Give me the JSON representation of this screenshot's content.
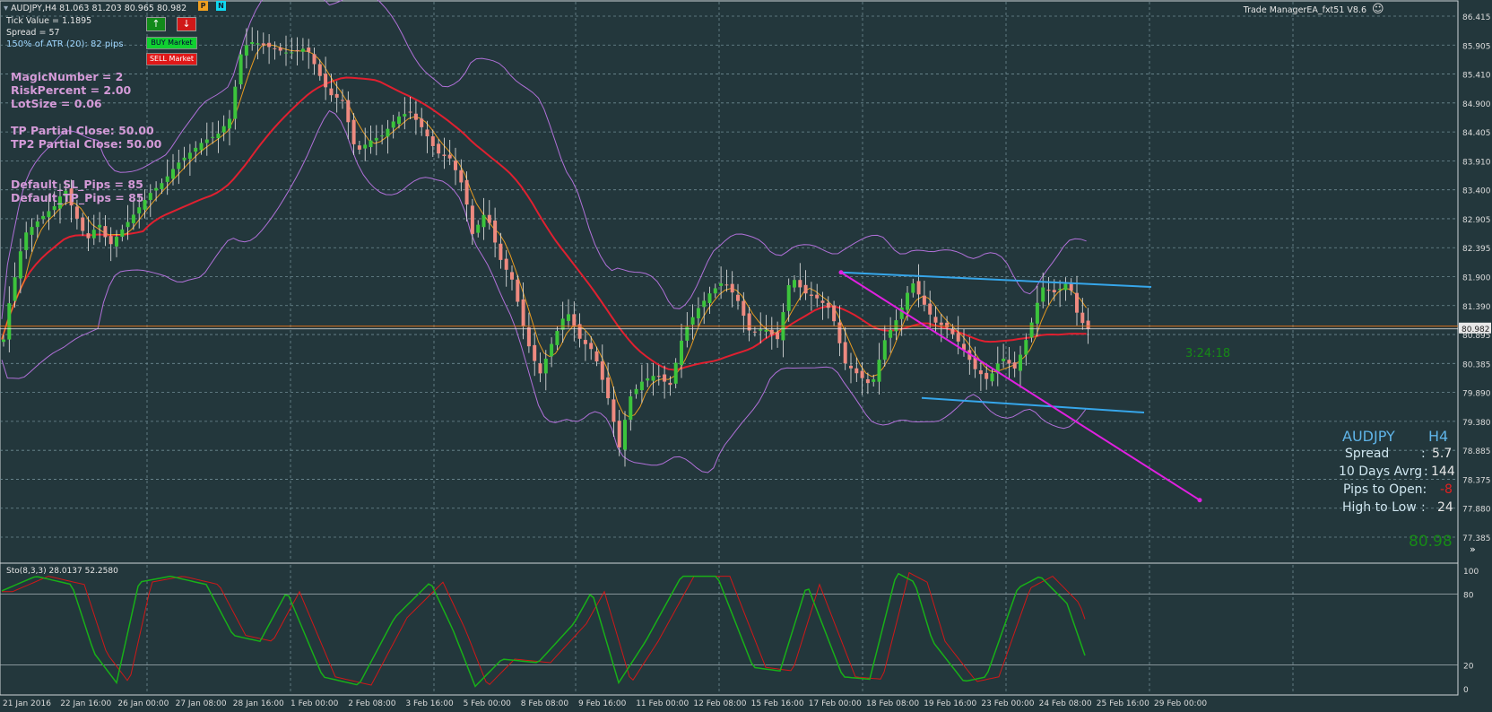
{
  "header": {
    "symbol_line": "AUDJPY,H4  81.063 81.203 80.965 80.982",
    "tick_value": "Tick Value = 1.1895",
    "spread": "Spread = 57",
    "atr": "150% of ATR (20): 82 pips",
    "ea_name": "Trade ManagerEA_fxt51 V8.6"
  },
  "buttons": {
    "up_arrow": "↑",
    "down_arrow": "↓",
    "p_label": "P",
    "n_label": "N",
    "buy": "BUY Market",
    "sell": "SELL Market"
  },
  "params": {
    "magic": "MagicNumber = 2",
    "risk": "RiskPercent = 2.00",
    "lot": "LotSize = 0.06",
    "tp1": "TP Partial Close: 50.00",
    "tp2": "TP2 Partial Close: 50.00",
    "sl": "Default_SL_Pips = 85",
    "tp": "Default_TP_Pips = 85"
  },
  "info_panel": {
    "symbol": "AUDJPY",
    "timeframe": "H4",
    "spread_label": "Spread",
    "spread_value": "5.7",
    "avg_label": "10 Days Avrg",
    "avg_value": "144",
    "pips_open_label": "Pips to Open:",
    "pips_open_value": "-8",
    "hl_label": "High to Low",
    "hl_value": "24",
    "price": "80.98",
    "countdown": "3:24:18"
  },
  "current_price_label": "80.982",
  "price_axis": [
    "86.415",
    "85.905",
    "85.410",
    "84.900",
    "84.405",
    "83.910",
    "83.400",
    "82.905",
    "82.395",
    "81.900",
    "81.390",
    "80.895",
    "80.385",
    "79.890",
    "79.380",
    "78.885",
    "78.375",
    "77.880",
    "77.385"
  ],
  "time_axis": [
    "21 Jan 2016",
    "22 Jan 16:00",
    "26 Jan 00:00",
    "27 Jan 08:00",
    "28 Jan 16:00",
    "1 Feb 00:00",
    "2 Feb 08:00",
    "3 Feb 16:00",
    "5 Feb 00:00",
    "8 Feb 08:00",
    "9 Feb 16:00",
    "11 Feb 00:00",
    "12 Feb 08:00",
    "15 Feb 16:00",
    "17 Feb 00:00",
    "18 Feb 08:00",
    "19 Feb 16:00",
    "23 Feb 00:00",
    "24 Feb 08:00",
    "25 Feb 16:00",
    "29 Feb 00:00"
  ],
  "stoch": {
    "label": "Sto(8,3,3) 28.0137 52.2580",
    "levels": [
      "100",
      "80",
      "20",
      "0"
    ]
  },
  "colors": {
    "background": "#23373c",
    "bull": "#3cc43c",
    "bear": "#ee8a80",
    "ma_red": "#e02030",
    "ma_blue": "#4a7ee8",
    "ma_orange": "#e79a20",
    "bands": "#b070d8",
    "trend_magenta": "#e020e0",
    "channel_blue": "#36a6ea",
    "stoch_main": "#18b018",
    "stoch_signal": "#d01818"
  },
  "chart_data": {
    "type": "candlestick",
    "symbol": "AUDJPY",
    "timeframe": "H4",
    "last": {
      "open": 81.063,
      "high": 81.203,
      "low": 80.965,
      "close": 80.982
    },
    "ylim": [
      77.385,
      86.415
    ],
    "anchors": [
      [
        0,
        80.6
      ],
      [
        8,
        81.4
      ],
      [
        25,
        82.6
      ],
      [
        45,
        82.9
      ],
      [
        60,
        83.1
      ],
      [
        70,
        83.4
      ],
      [
        80,
        83.0
      ],
      [
        95,
        82.5
      ],
      [
        108,
        82.8
      ],
      [
        120,
        82.4
      ],
      [
        135,
        82.7
      ],
      [
        150,
        83.0
      ],
      [
        165,
        83.3
      ],
      [
        180,
        83.5
      ],
      [
        195,
        83.8
      ],
      [
        210,
        84.0
      ],
      [
        225,
        84.2
      ],
      [
        240,
        84.3
      ],
      [
        255,
        84.6
      ],
      [
        262,
        85.3
      ],
      [
        268,
        85.8
      ],
      [
        280,
        85.9
      ],
      [
        300,
        85.8
      ],
      [
        320,
        85.7
      ],
      [
        340,
        85.8
      ],
      [
        352,
        85.4
      ],
      [
        365,
        85.0
      ],
      [
        380,
        84.9
      ],
      [
        395,
        84.0
      ],
      [
        410,
        84.2
      ],
      [
        425,
        84.3
      ],
      [
        440,
        84.6
      ],
      [
        455,
        84.7
      ],
      [
        470,
        84.4
      ],
      [
        485,
        84.0
      ],
      [
        500,
        83.9
      ],
      [
        515,
        83.4
      ],
      [
        525,
        82.6
      ],
      [
        540,
        83.0
      ],
      [
        555,
        82.2
      ],
      [
        570,
        81.8
      ],
      [
        585,
        80.8
      ],
      [
        600,
        80.2
      ],
      [
        615,
        80.8
      ],
      [
        630,
        81.3
      ],
      [
        645,
        80.8
      ],
      [
        660,
        80.6
      ],
      [
        670,
        80.1
      ],
      [
        680,
        79.6
      ],
      [
        688,
        78.9
      ],
      [
        700,
        79.8
      ],
      [
        715,
        80.1
      ],
      [
        730,
        80.2
      ],
      [
        745,
        80.0
      ],
      [
        760,
        80.9
      ],
      [
        775,
        81.3
      ],
      [
        790,
        81.6
      ],
      [
        805,
        81.8
      ],
      [
        820,
        81.5
      ],
      [
        835,
        80.9
      ],
      [
        850,
        81.0
      ],
      [
        865,
        80.8
      ],
      [
        880,
        81.9
      ],
      [
        895,
        81.6
      ],
      [
        910,
        81.5
      ],
      [
        925,
        81.3
      ],
      [
        940,
        80.4
      ],
      [
        955,
        80.2
      ],
      [
        970,
        80.0
      ],
      [
        985,
        80.8
      ],
      [
        1000,
        81.2
      ],
      [
        1015,
        81.8
      ],
      [
        1025,
        81.5
      ],
      [
        1040,
        81.1
      ],
      [
        1055,
        81.0
      ],
      [
        1070,
        80.7
      ],
      [
        1085,
        80.3
      ],
      [
        1100,
        80.1
      ],
      [
        1115,
        80.5
      ],
      [
        1130,
        80.3
      ],
      [
        1145,
        80.9
      ],
      [
        1160,
        81.7
      ],
      [
        1175,
        81.6
      ],
      [
        1190,
        81.8
      ],
      [
        1200,
        81.2
      ],
      [
        1210,
        80.98
      ]
    ],
    "stoch_anchors": [
      [
        0,
        82
      ],
      [
        40,
        95
      ],
      [
        80,
        88
      ],
      [
        105,
        30
      ],
      [
        130,
        5
      ],
      [
        155,
        90
      ],
      [
        190,
        95
      ],
      [
        230,
        88
      ],
      [
        260,
        45
      ],
      [
        290,
        40
      ],
      [
        320,
        82
      ],
      [
        360,
        10
      ],
      [
        400,
        3
      ],
      [
        440,
        60
      ],
      [
        480,
        90
      ],
      [
        505,
        50
      ],
      [
        530,
        2
      ],
      [
        560,
        25
      ],
      [
        600,
        22
      ],
      [
        640,
        55
      ],
      [
        660,
        82
      ],
      [
        690,
        5
      ],
      [
        720,
        40
      ],
      [
        760,
        95
      ],
      [
        800,
        95
      ],
      [
        840,
        18
      ],
      [
        870,
        15
      ],
      [
        900,
        88
      ],
      [
        940,
        10
      ],
      [
        970,
        8
      ],
      [
        1000,
        98
      ],
      [
        1020,
        90
      ],
      [
        1040,
        40
      ],
      [
        1075,
        6
      ],
      [
        1100,
        10
      ],
      [
        1135,
        85
      ],
      [
        1160,
        95
      ],
      [
        1190,
        72
      ],
      [
        1210,
        28
      ]
    ]
  }
}
